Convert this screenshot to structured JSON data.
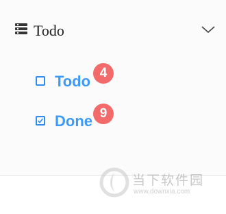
{
  "header": {
    "title": "Todo",
    "icon": "list-icon",
    "toggle_icon": "chevron-down-icon"
  },
  "items": [
    {
      "label": "Todo",
      "count": "4",
      "checked": false
    },
    {
      "label": "Done",
      "count": "9",
      "checked": true
    }
  ],
  "colors": {
    "accent": "#3d9af5",
    "badge": "#f26a6a",
    "header_text": "#222222"
  },
  "watermark": {
    "name": "当下软件园",
    "url": "www.downxia.com"
  }
}
